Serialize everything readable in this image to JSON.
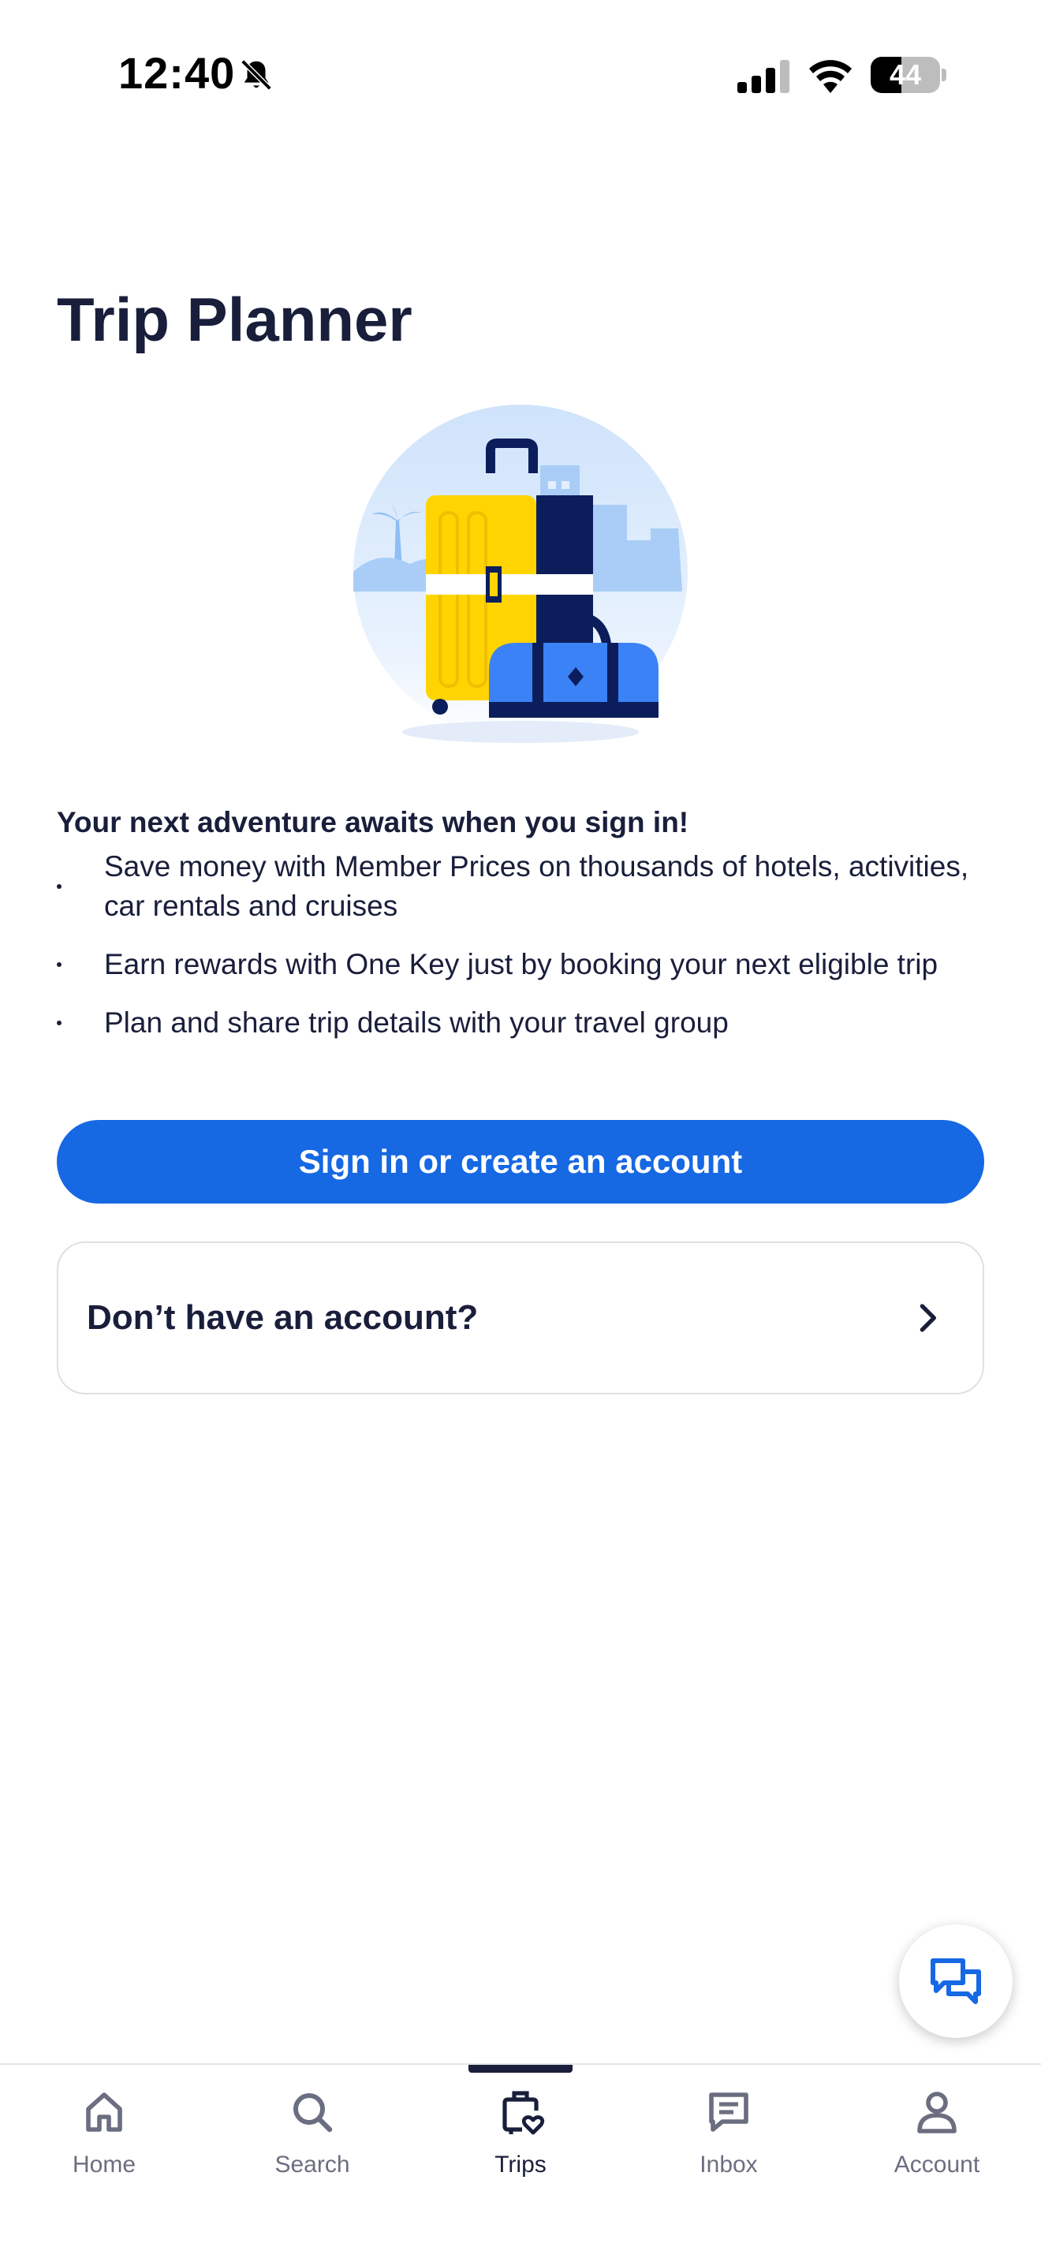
{
  "status_bar": {
    "time": "12:40",
    "battery_level": "44",
    "battery_fraction": 0.44,
    "icons": [
      "bell-slash-icon",
      "cellular-signal-icon",
      "wifi-icon",
      "battery-icon"
    ]
  },
  "page": {
    "title": "Trip Planner"
  },
  "content": {
    "headline": "Your next adventure awaits when you sign in!",
    "benefits": [
      "Save money with Member Prices on thousands of hotels, activities, car rentals and cruises",
      "Earn rewards with One Key just by booking your next eligible trip",
      "Plan and share trip details with your travel group"
    ],
    "signin_button": "Sign in or create an account",
    "no_account_label": "Don’t have an account?"
  },
  "colors": {
    "primary": "#1668e3",
    "text": "#191e3b",
    "muted": "#6b6e80",
    "luggage_yellow": "#ffd400",
    "luggage_navy": "#0b1e5b",
    "bag_blue": "#3b82f6"
  },
  "bottom_nav": {
    "active": "Trips",
    "items": [
      {
        "label": "Home",
        "icon": "home-icon"
      },
      {
        "label": "Search",
        "icon": "search-icon"
      },
      {
        "label": "Trips",
        "icon": "trips-luggage-icon"
      },
      {
        "label": "Inbox",
        "icon": "inbox-icon"
      },
      {
        "label": "Account",
        "icon": "account-icon"
      }
    ]
  }
}
